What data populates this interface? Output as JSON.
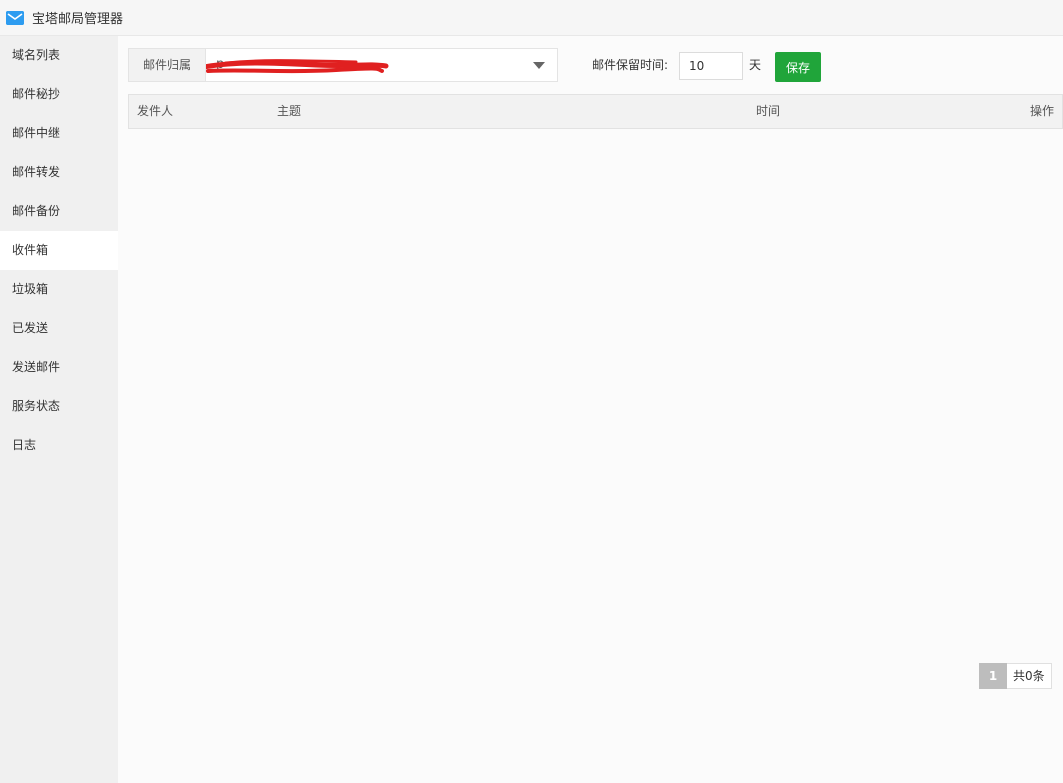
{
  "window": {
    "title": "宝塔邮局管理器"
  },
  "sidebar": {
    "items": [
      {
        "label": "域名列表"
      },
      {
        "label": "邮件秘抄"
      },
      {
        "label": "邮件中继"
      },
      {
        "label": "邮件转发"
      },
      {
        "label": "邮件备份"
      },
      {
        "label": "收件箱"
      },
      {
        "label": "垃圾箱"
      },
      {
        "label": "已发送"
      },
      {
        "label": "发送邮件"
      },
      {
        "label": "服务状态"
      },
      {
        "label": "日志"
      }
    ],
    "active_index": 5
  },
  "toolbar": {
    "owner_label": "邮件归属",
    "owner_value": "p",
    "retain_label": "邮件保留时间:",
    "retain_value": "10",
    "retain_unit": "天",
    "save_label": "保存"
  },
  "table": {
    "columns": [
      "发件人",
      "主题",
      "时间",
      "操作"
    ],
    "rows": []
  },
  "pager": {
    "current_page": "1",
    "total_text": "共0条"
  },
  "colors": {
    "accent_green": "#20a53a",
    "redaction_red": "#e02020"
  },
  "icons": {
    "app": "mail-icon",
    "dropdown": "chevron-down-icon"
  }
}
